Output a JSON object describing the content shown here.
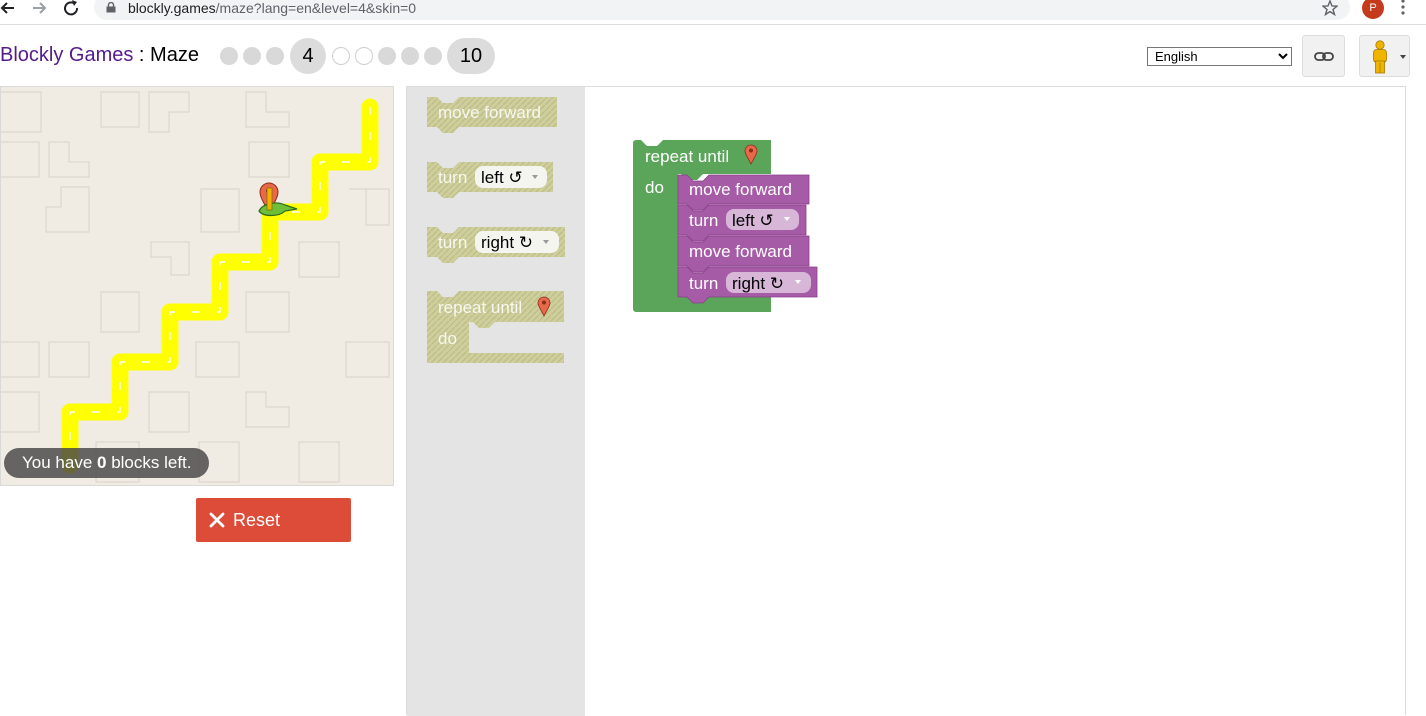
{
  "browser": {
    "url_host": "blockly.games",
    "url_rest": "/maze?lang=en&level=4&skin=0",
    "profile_initial": "P"
  },
  "header": {
    "brand": "Blockly Games",
    "separator": " : ",
    "game": "Maze",
    "levels": {
      "current": "4",
      "last": "10"
    },
    "language": "English",
    "language_options": [
      "English"
    ]
  },
  "maze": {
    "capacity_prefix": "You have ",
    "capacity_count": "0",
    "capacity_suffix": " blocks left.",
    "reset_label": "Reset"
  },
  "toolbox": {
    "move_forward": "move forward",
    "turn": "turn",
    "left": "left ↺",
    "right": "right ↻",
    "repeat_until": "repeat until",
    "do": "do"
  },
  "workspace": {
    "repeat_until": "repeat until",
    "do": "do",
    "move_forward_1": "move forward",
    "turn_1": "turn",
    "turn_1_dir": "left ↺",
    "move_forward_2": "move forward",
    "turn_2": "turn",
    "turn_2_dir": "right ↻"
  },
  "colors": {
    "loop_block": "#5ba55b",
    "movement_block": "#a55ba5",
    "path": "#ffff00",
    "reset": "#dd4b39"
  }
}
